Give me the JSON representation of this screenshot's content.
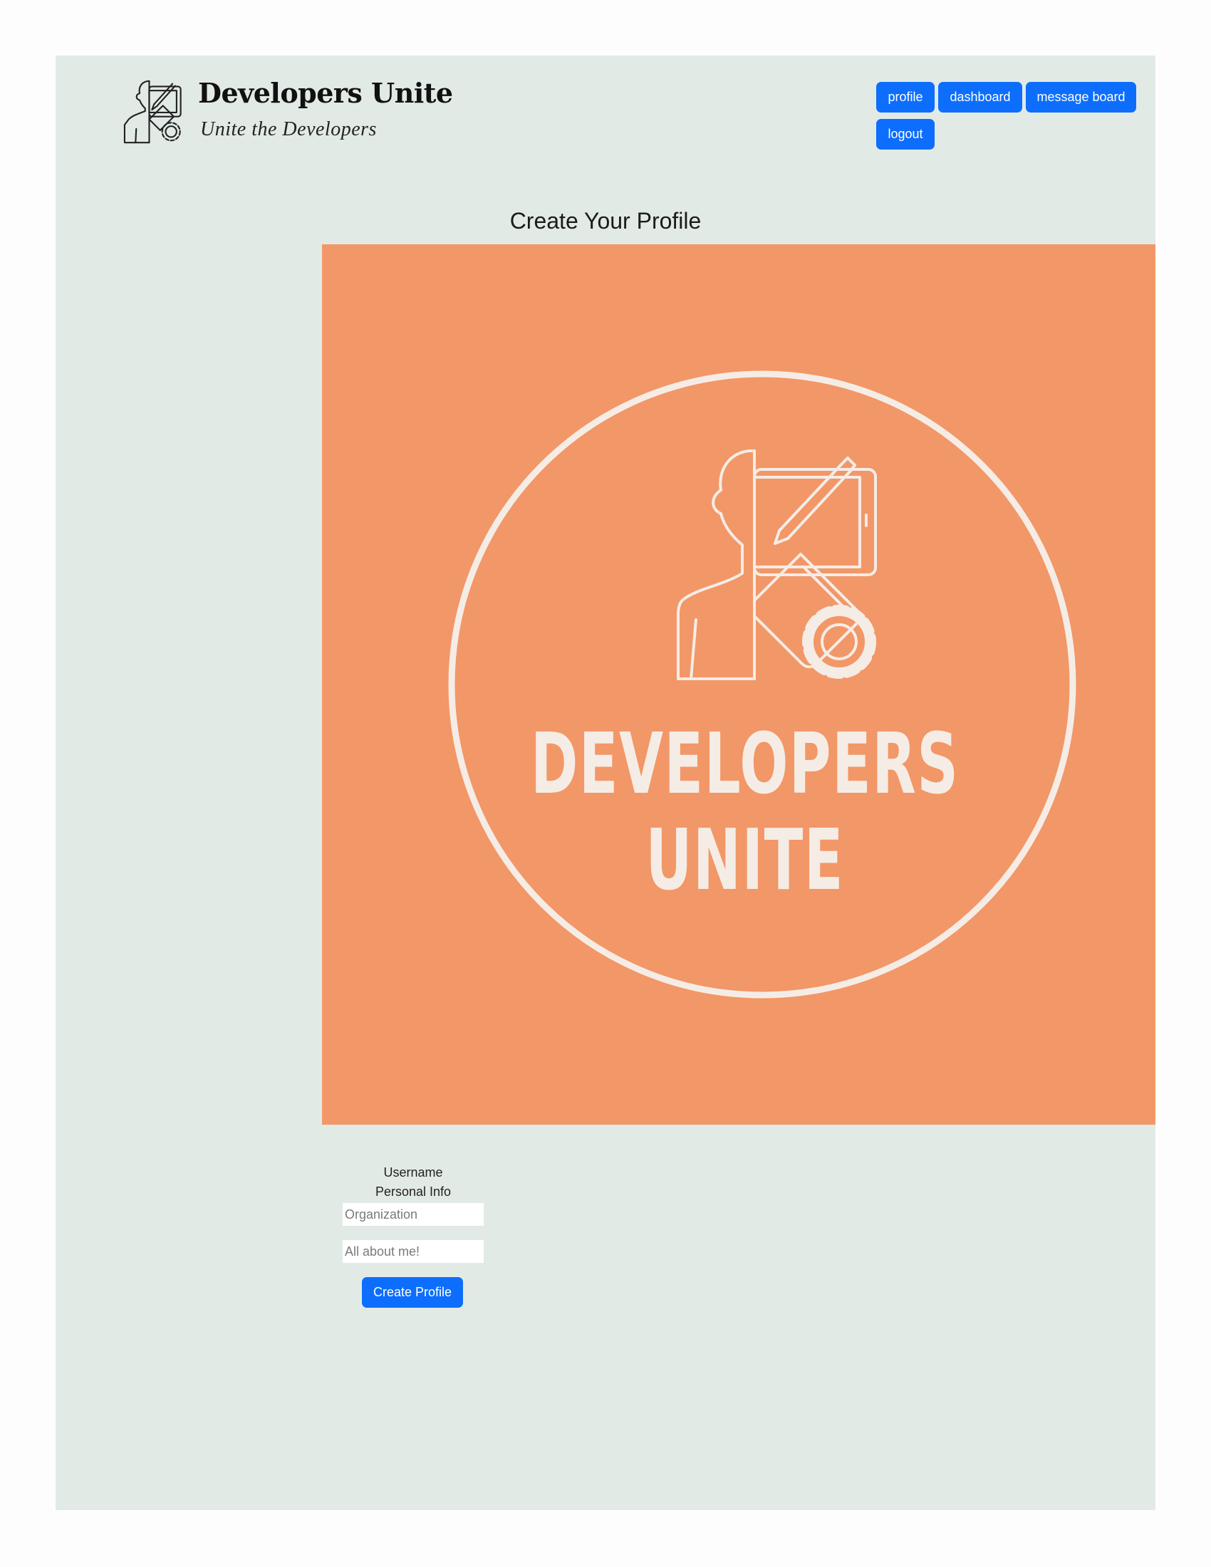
{
  "header": {
    "brand_title": "Developers Unite",
    "brand_tagline": "Unite the Developers"
  },
  "nav": {
    "profile": "profile",
    "dashboard": "dashboard",
    "message_board": "message board",
    "logout": "logout"
  },
  "page_title": "Create Your Profile",
  "hero": {
    "line1": "DEVELOPERS",
    "line2": "UNITE",
    "background_color": "#f29767",
    "foreground_color": "#f6ece6"
  },
  "form": {
    "username_label": "Username",
    "personal_info_label": "Personal Info",
    "organization_placeholder": "Organization",
    "about_placeholder": "All about me!",
    "submit_label": "Create Profile"
  },
  "colors": {
    "page_background": "#e2eae6",
    "accent": "#0d6efd"
  }
}
